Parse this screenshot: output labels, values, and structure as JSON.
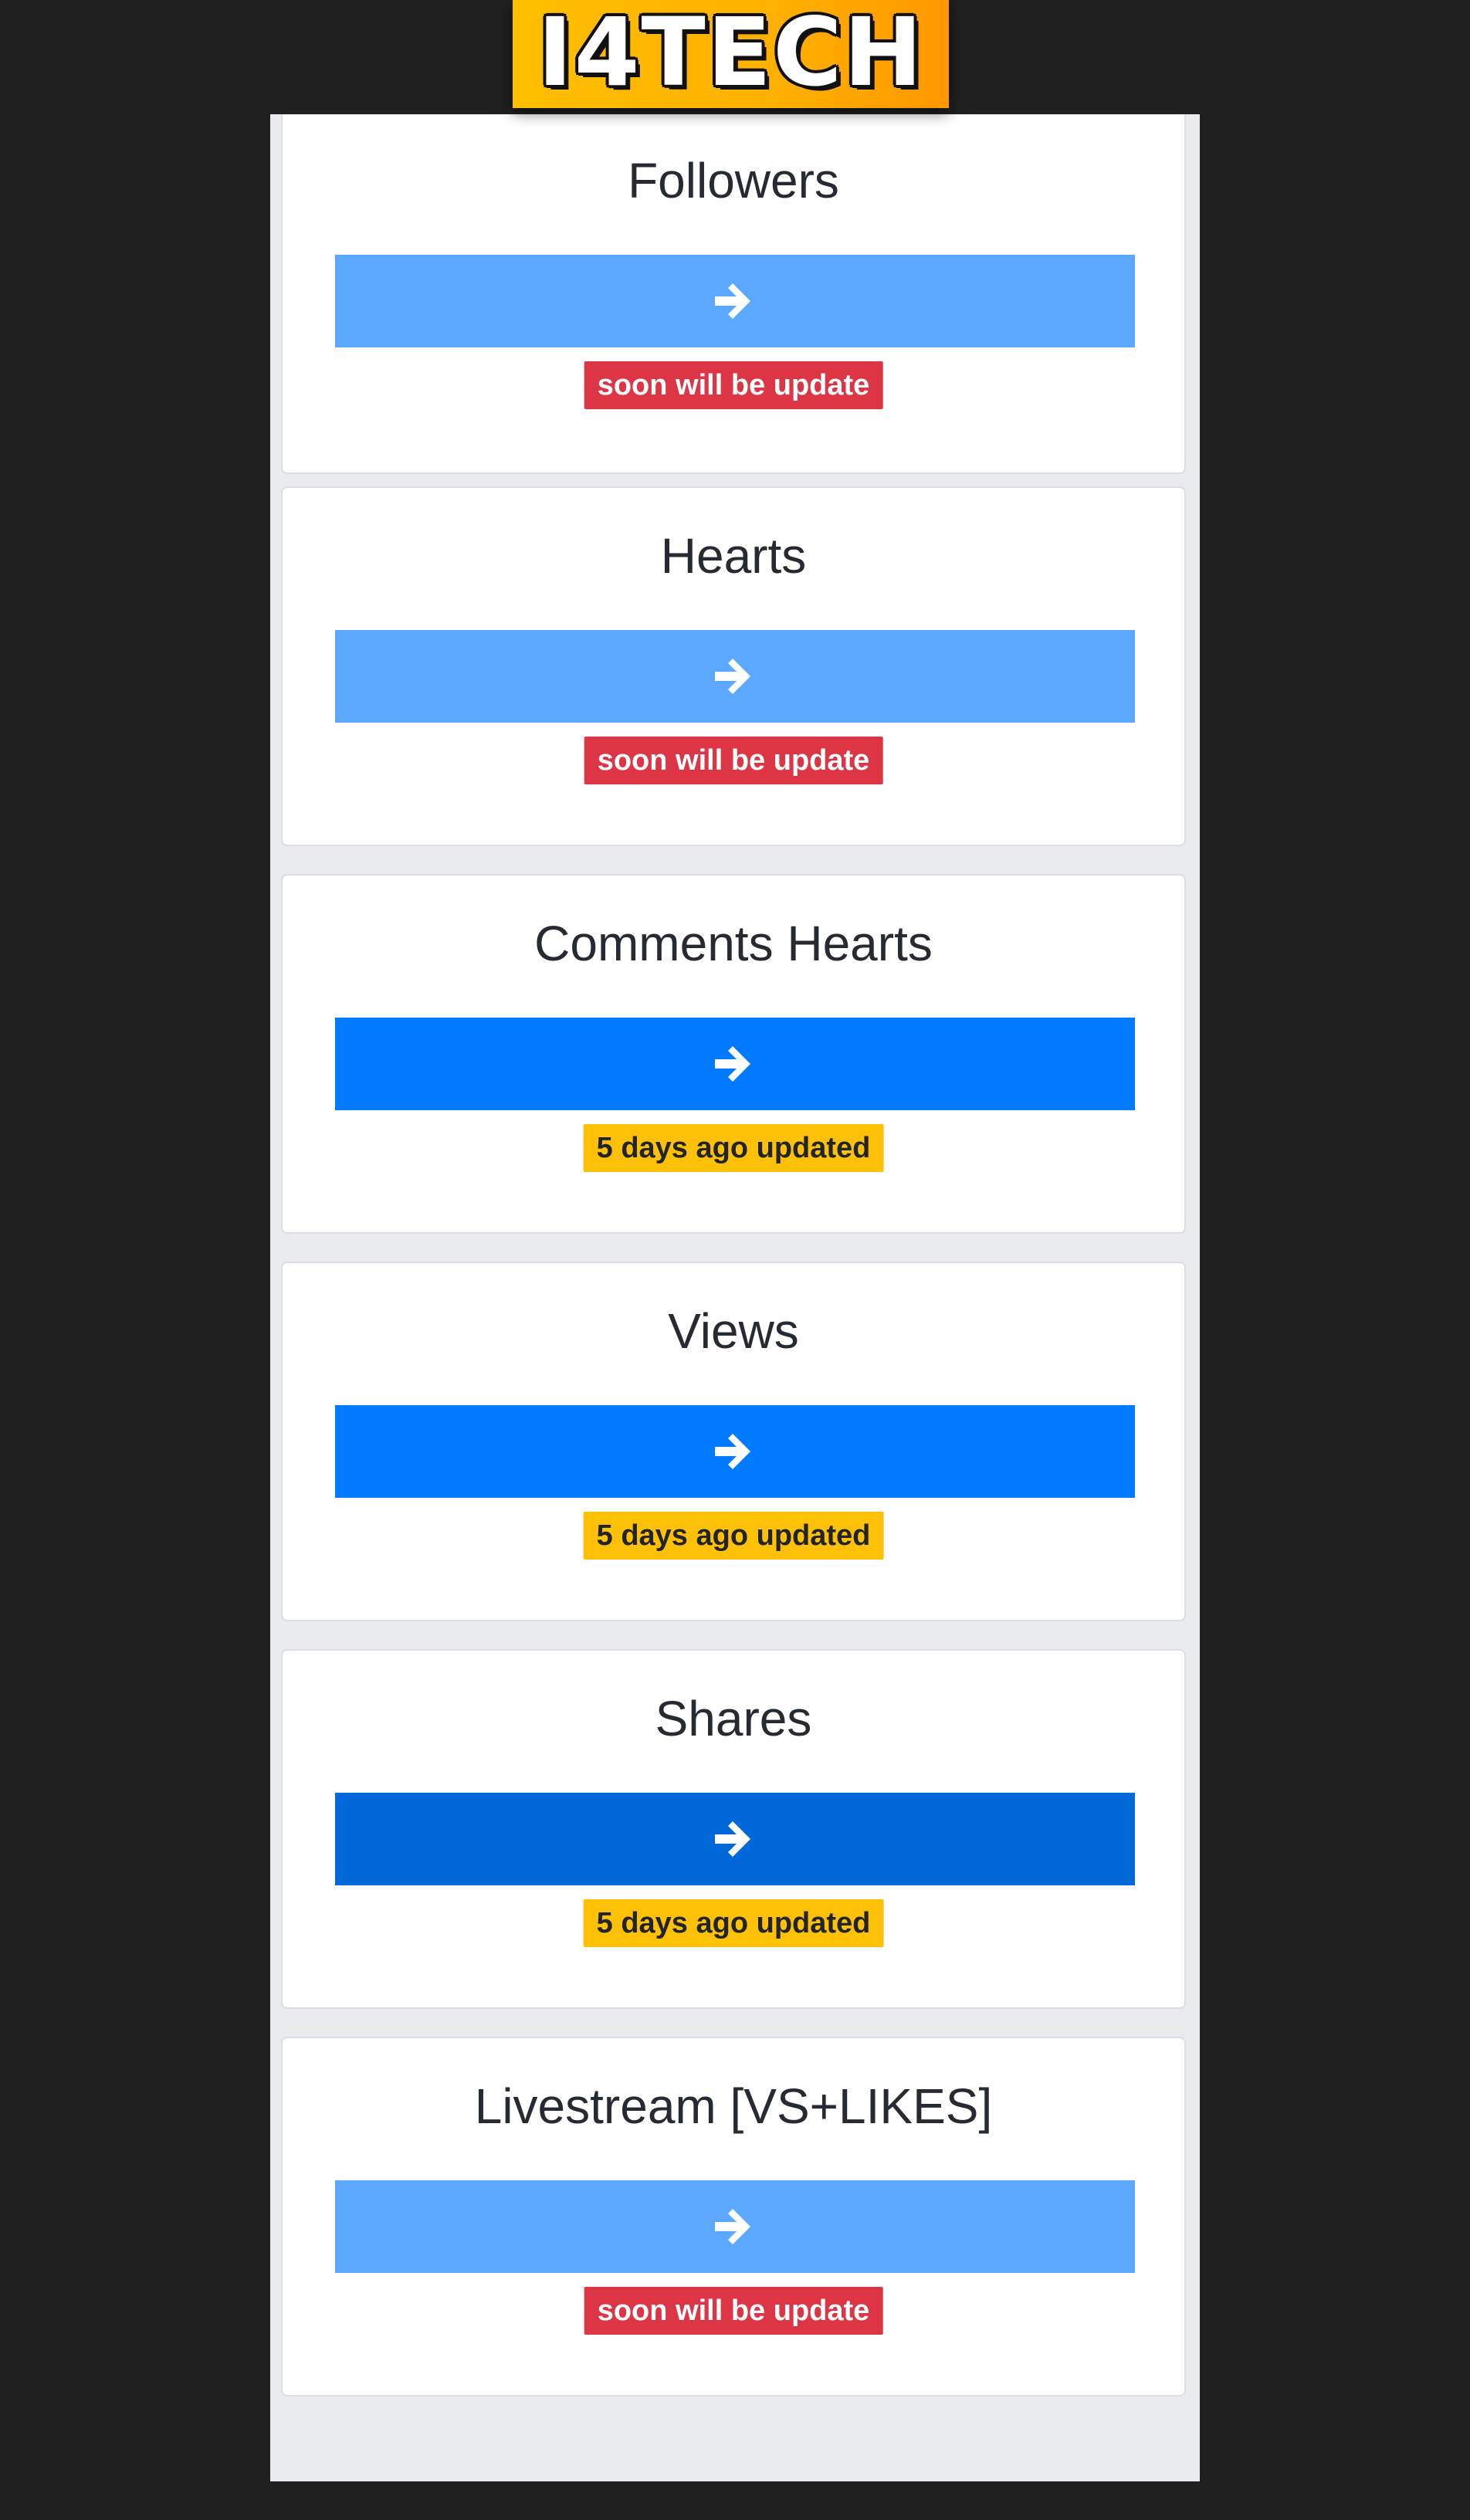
{
  "brand": {
    "logo_text": "I4TECH"
  },
  "theme": {
    "page_background": "#202020",
    "panel_background": "#e9ebee",
    "card_background": "#ffffff",
    "button_light": "#5aa9fe",
    "button_primary": "#007afe",
    "button_dark": "#0068d8",
    "badge_red": "#dc3545",
    "badge_yellow": "#ffc107"
  },
  "services": [
    {
      "title": "Followers",
      "button_icon": "arrow-right-icon",
      "button_style": "light",
      "status": "soon will be update",
      "status_style": "red"
    },
    {
      "title": "Hearts",
      "button_icon": "arrow-right-icon",
      "button_style": "light",
      "status": "soon will be update",
      "status_style": "red"
    },
    {
      "title": "Comments Hearts",
      "button_icon": "arrow-right-icon",
      "button_style": "primary",
      "status": "5 days ago updated",
      "status_style": "yellow"
    },
    {
      "title": "Views",
      "button_icon": "arrow-right-icon",
      "button_style": "primary",
      "status": "5 days ago updated",
      "status_style": "yellow"
    },
    {
      "title": "Shares",
      "button_icon": "arrow-right-icon",
      "button_style": "dark",
      "status": "5 days ago updated",
      "status_style": "yellow"
    },
    {
      "title": "Livestream [VS+LIKES]",
      "button_icon": "arrow-right-icon",
      "button_style": "light",
      "status": "soon will be update",
      "status_style": "red"
    }
  ]
}
